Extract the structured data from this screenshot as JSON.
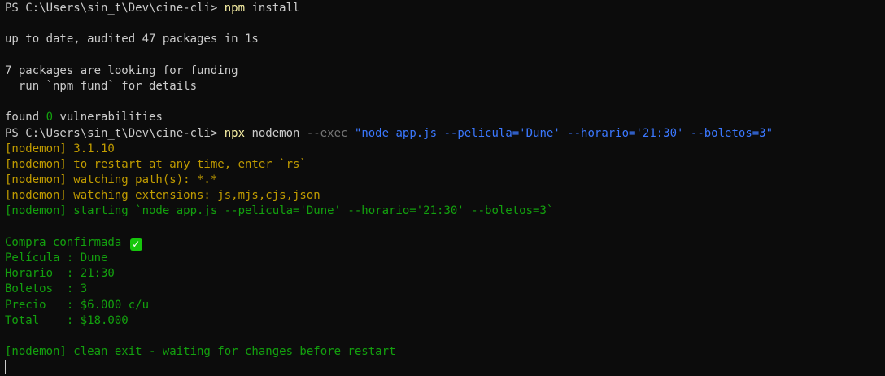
{
  "colors": {
    "background": "#0c0c0c",
    "text": "#cccccc",
    "command": "#f9f1a5",
    "nodemon": "#c19c00",
    "nodemon_status": "#13a10e",
    "string": "#3b78ff",
    "option": "#767676",
    "check": "#16c60c"
  },
  "lines": {
    "l1": {
      "prompt": "PS C:\\Users\\sin_t\\Dev\\cine-cli> ",
      "command": "npm",
      "args": " install"
    },
    "l2": "up to date, audited 47 packages in 1s",
    "l3": "7 packages are looking for funding",
    "l4": "  run `npm fund` for details",
    "l5": {
      "prefix": "found ",
      "count": "0",
      "suffix": " vulnerabilities"
    },
    "l6": {
      "prompt": "PS C:\\Users\\sin_t\\Dev\\cine-cli> ",
      "command": "npx",
      "args": " nodemon ",
      "option": "--exec",
      "space": " ",
      "string": "\"node app.js --pelicula='Dune' --horario='21:30' --boletos=3\""
    },
    "l7": "[nodemon] 3.1.10",
    "l8": "[nodemon] to restart at any time, enter `rs`",
    "l9": "[nodemon] watching path(s): *.*",
    "l10": "[nodemon] watching extensions: js,mjs,cjs,json",
    "l11": "[nodemon] starting `node app.js --pelicula='Dune' --horario='21:30' --boletos=3`",
    "l12": {
      "text": "Compra confirmada ",
      "icon": "check-mark-icon",
      "glyph": "✓"
    },
    "l13": "Película : Dune",
    "l14": "Horario  : 21:30",
    "l15": "Boletos  : 3",
    "l16": "Precio   : $6.000 c/u",
    "l17": "Total    : $18.000",
    "l18": "[nodemon] clean exit - waiting for changes before restart"
  }
}
